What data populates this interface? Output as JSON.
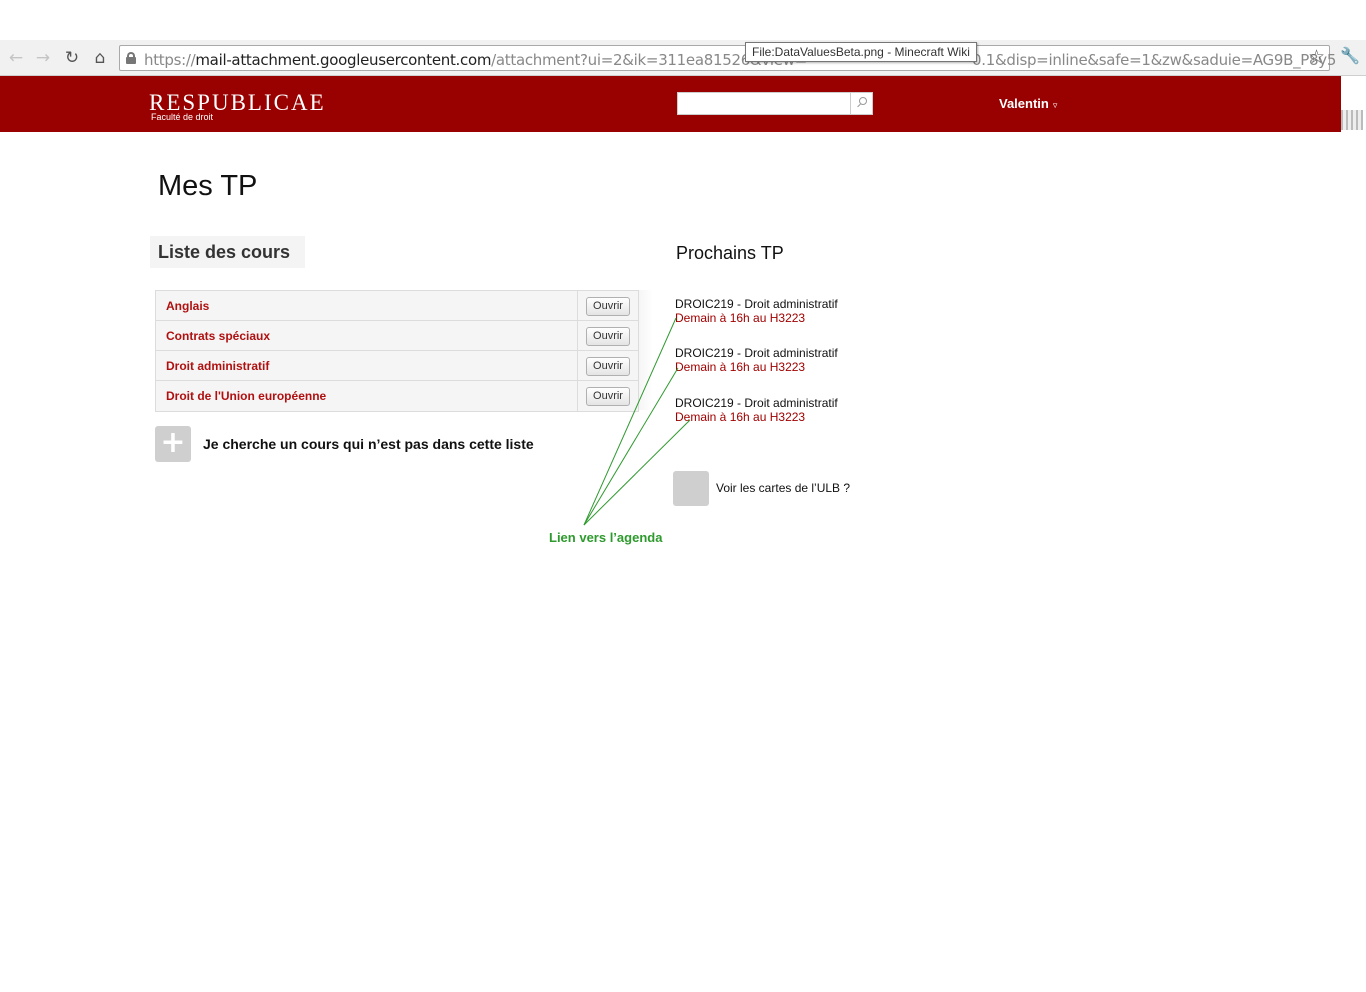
{
  "browser": {
    "url_host": "mail-attachment.googleusercontent.com",
    "url_scheme": "https://",
    "url_path_start": "/attachment?ui=2&ik=311ea81526&view=",
    "url_path_end": "0.1&disp=inline&safe=1&zw&saduie=AG9B_P8y5",
    "tooltip": "File:DataValuesBeta.png - Minecraft Wiki",
    "back_icon": "←",
    "forward_icon": "→",
    "reload_icon": "↻",
    "home_icon": "⌂",
    "star_icon": "☆",
    "wrench_icon": "🔧"
  },
  "header": {
    "logo": "RESPUBLICAE",
    "logo_sub": "Faculté de droit",
    "search_placeholder": "",
    "user": "Valentin",
    "user_caret": "▿",
    "brand_color": "#990000"
  },
  "main": {
    "title": "Mes TP",
    "courses_heading": "Liste des cours",
    "courses": [
      {
        "name": "Anglais",
        "action": "Ouvrir"
      },
      {
        "name": "Contrats spéciaux",
        "action": "Ouvrir"
      },
      {
        "name": "Droit administratif",
        "action": "Ouvrir"
      },
      {
        "name": "Droit de l'Union européenne",
        "action": "Ouvrir"
      }
    ],
    "add_icon": "+",
    "add_course_label": "Je cherche un cours qui n’est pas dans cette liste"
  },
  "upcoming": {
    "title": "Prochains TP",
    "items": [
      {
        "course": "DROIC219 - Droit administratif",
        "when": "Demain à 16h au H3223"
      },
      {
        "course": "DROIC219 - Droit administratif",
        "when": "Demain à 16h au H3223"
      },
      {
        "course": "DROIC219 - Droit administratif",
        "when": "Demain à 16h au H3223"
      }
    ],
    "map_label": "Voir les cartes de l’ULB ?"
  },
  "annotation": {
    "label": "Lien vers l’agenda",
    "color": "#2e9a2e"
  }
}
